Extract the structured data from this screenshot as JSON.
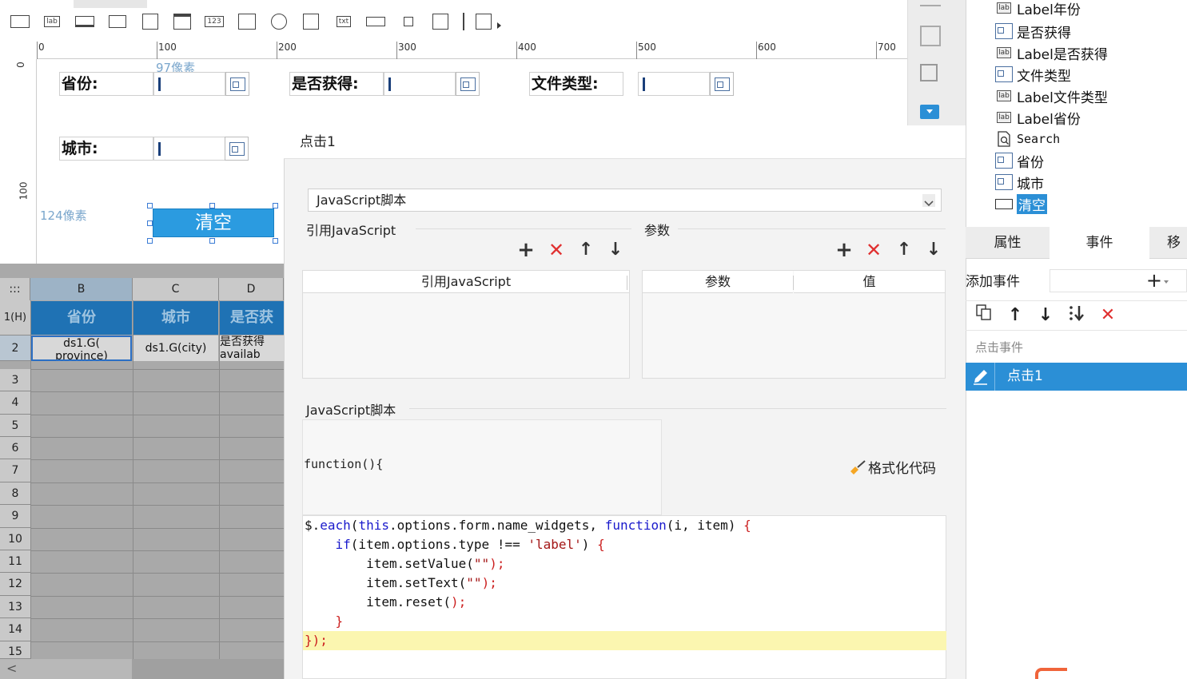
{
  "toolbar": {
    "icons": [
      "textbox-icon",
      "label-icon",
      "button-icon",
      "combo-icon",
      "tree-combo-icon",
      "date-icon",
      "number-icon",
      "textarea-icon",
      "radio-group-icon",
      "checkbox-group-icon",
      "text-widget-icon",
      "password-icon",
      "checkbox-icon",
      "tree-icon",
      "separator",
      "report-icon"
    ]
  },
  "ruler": {
    "h_ticks": [
      "0",
      "100",
      "200",
      "300",
      "400",
      "500",
      "600",
      "700"
    ],
    "v_ticks": [
      "0",
      "100"
    ],
    "guide_97": "97像素",
    "guide_124": "124像素"
  },
  "form": {
    "province_label": "省份:",
    "obtained_label": "是否获得:",
    "filetype_label": "文件类型:",
    "city_label": "城市:",
    "clear_button": "清空"
  },
  "sheet": {
    "corner": ":::",
    "columns": [
      "B",
      "C",
      "D"
    ],
    "rows": [
      "1(H)",
      "2",
      "3",
      "4",
      "5",
      "6",
      "7",
      "8",
      "9",
      "10",
      "11",
      "12",
      "13",
      "14",
      "15"
    ],
    "headers": [
      "省份",
      "城市",
      "是否获"
    ],
    "row2": [
      "ds1.G(\nprovince)",
      "ds1.G(city)",
      "是否获得\navailab"
    ],
    "scroll_left": "<"
  },
  "dialog": {
    "title": "点击1",
    "type_select": "JavaScript脚本",
    "ref_js_section": "引用JavaScript",
    "params_section": "参数",
    "ref_js_col": "引用JavaScript",
    "param_col": "参数",
    "value_col": "值",
    "op_add": "+",
    "op_del": "✕",
    "op_up": "↑",
    "op_down": "↓",
    "script_section": "JavaScript脚本",
    "fn_header": "function(){",
    "format_code": "格式化代码",
    "code_lines": [
      "$.each(this.options.form.name_widgets, function(i, item) {",
      "    if(item.options.type !== 'label') {",
      "        item.setValue(\"\");",
      "        item.setText(\"\");",
      "        item.reset();",
      "    }",
      "});"
    ]
  },
  "tree": {
    "items": [
      {
        "icon": "label-icon",
        "label": "Label年份"
      },
      {
        "icon": "widget-icon",
        "label": "是否获得"
      },
      {
        "icon": "label-icon",
        "label": "Label是否获得"
      },
      {
        "icon": "widget-icon",
        "label": "文件类型"
      },
      {
        "icon": "label-icon",
        "label": "Label文件类型"
      },
      {
        "icon": "label-icon",
        "label": "Label省份"
      },
      {
        "icon": "search-icon",
        "label": "Search"
      },
      {
        "icon": "widget-icon",
        "label": "省份"
      },
      {
        "icon": "widget-icon",
        "label": "城市"
      },
      {
        "icon": "button-icon",
        "label": "清空"
      }
    ]
  },
  "right_panel": {
    "tabs": [
      "属性",
      "事件",
      "移"
    ],
    "add_event_label": "添加事件",
    "add_event_btn": "+",
    "evt_toolbar": [
      "copy-icon",
      "up-arrow-icon",
      "down-arrow-icon",
      "sort-icon",
      "delete-icon"
    ],
    "click_event_group": "点击事件",
    "event_item": "点击1"
  },
  "colors": {
    "accent": "#2b8fd6",
    "header_blue": "#1f72b4",
    "delete_red": "#e03030",
    "code_highlight": "#fbf6b0"
  }
}
